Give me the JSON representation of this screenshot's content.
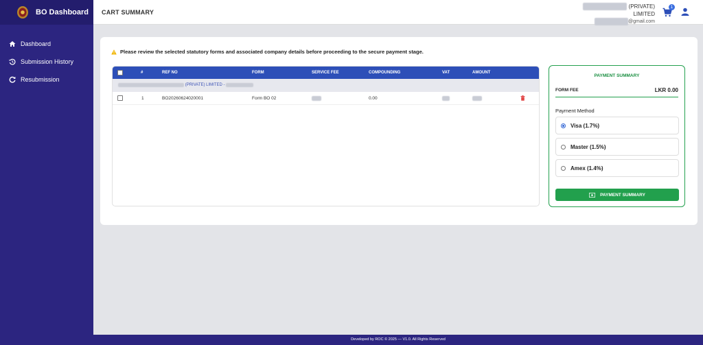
{
  "sidebar": {
    "brand": "BO Dashboard",
    "items": [
      {
        "label": "Dashboard",
        "icon": "home-icon"
      },
      {
        "label": "Submission History",
        "icon": "history-icon"
      },
      {
        "label": "Resubmission",
        "icon": "refresh-icon"
      }
    ]
  },
  "header": {
    "title": "CART SUMMARY",
    "company_suffix": "(PRIVATE)",
    "company_line2": "LIMITED",
    "email_domain": "@gmail.com",
    "cart_count": "1"
  },
  "notice": "Please review the selected statutory forms and associated company details before proceeding to the secure payment stage.",
  "table": {
    "columns": [
      "#",
      "REF NO",
      "FORM",
      "SERVICE FEE",
      "COMPOUNDING",
      "VAT",
      "AMOUNT"
    ],
    "group": {
      "suffix": "(PRIVATE) LIMITED"
    },
    "rows": [
      {
        "num": "1",
        "ref": "BO20260624020001",
        "form": "Form BO 02",
        "compounding": "0.00"
      }
    ]
  },
  "payment": {
    "title": "PAYMENT SUMMARY",
    "fee_label": "FORM FEE",
    "fee_value": "LKR 0.00",
    "method_label": "Payment Method",
    "options": [
      {
        "label": "Visa (1.7%)",
        "selected": true
      },
      {
        "label": "Master (1.5%)",
        "selected": false
      },
      {
        "label": "Amex (1.4%)",
        "selected": false
      }
    ],
    "button": "PAYMENT SUMMARY"
  },
  "footer": "Developed by ROC © 2025 — V1.0. All Rights Reserved",
  "colors": {
    "sidebar": "#2c2580",
    "table_header": "#2d4fb8",
    "accent_green": "#22a04d"
  }
}
